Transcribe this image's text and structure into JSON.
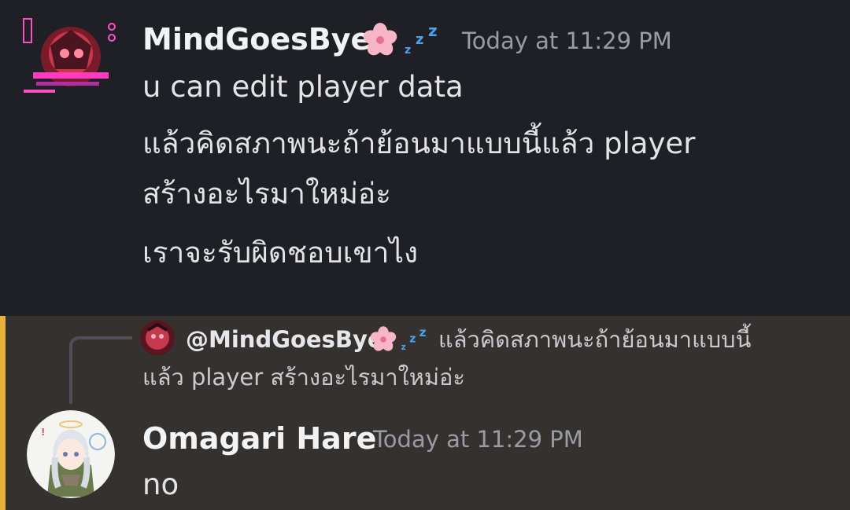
{
  "message1": {
    "author": "MindGoesBye",
    "author_emojis": [
      "cherry-blossom",
      "zzz"
    ],
    "timestamp": "Today at 11:29 PM",
    "lines": [
      "u can edit player data",
      "แล้วคิดสภาพนะถ้าย้อนมาแบบนี้แล้ว player",
      "สร้างอะไรมาใหม่อ่ะ",
      "เราจะรับผิดชอบเขาไง"
    ]
  },
  "reply_preview": {
    "mention": "@MindGoesBye",
    "text_line1": "แล้วคิดสภาพนะถ้าย้อนมาแบบนี้",
    "text_line2": "แล้ว player สร้างอะไรมาใหม่อ่ะ"
  },
  "message2": {
    "author": "Omagari Hare",
    "timestamp": "Today at 11:29 PM",
    "text": "no"
  },
  "colors": {
    "background": "#1f2026",
    "highlight_background": "#34312e",
    "mention_accent": "#e8b23a",
    "username": "#f2f3f5",
    "timestamp": "#9a9ca5"
  }
}
